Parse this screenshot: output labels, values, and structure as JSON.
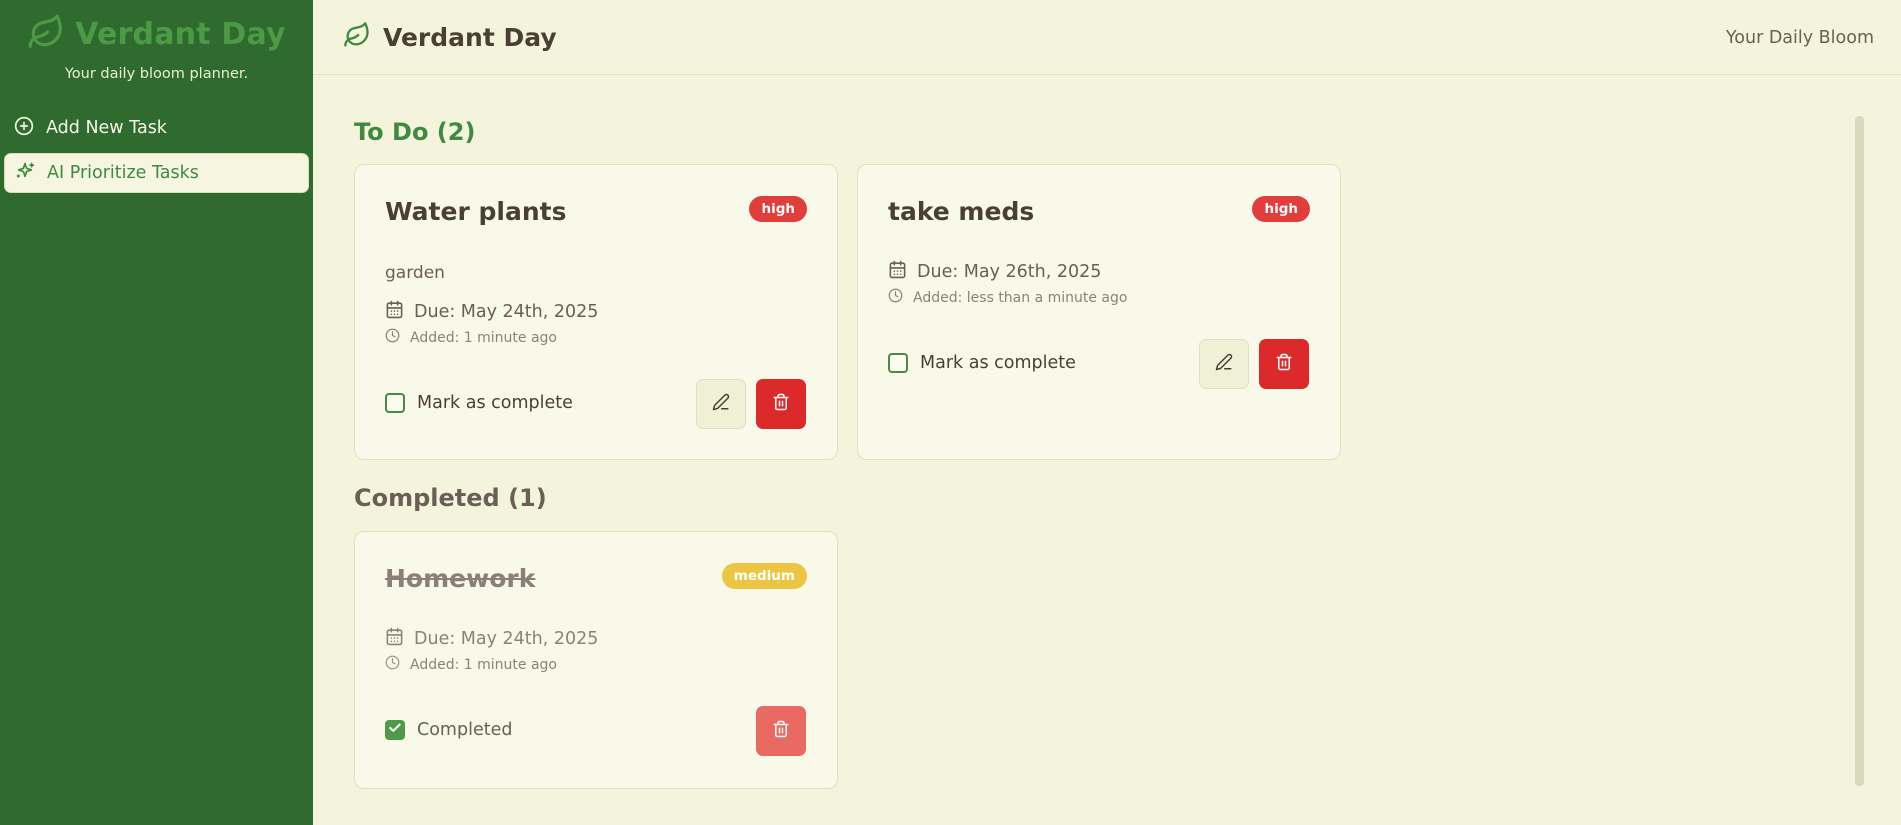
{
  "app": {
    "name": "Verdant Day",
    "tagline": "Your daily bloom planner.",
    "header_right": "Your Daily Bloom"
  },
  "sidebar": {
    "items": [
      {
        "label": "Add New Task",
        "icon": "plus-circle-icon"
      },
      {
        "label": "AI Prioritize Tasks",
        "icon": "sparkles-icon",
        "active": true
      }
    ]
  },
  "sections": {
    "todo_title": "To Do (2)",
    "completed_title": "Completed (1)"
  },
  "tasks": {
    "todo": [
      {
        "title": "Water plants",
        "priority": "high",
        "description": "garden",
        "due": "Due: May 24th, 2025",
        "added": "Added: 1 minute ago",
        "checkbox_label": "Mark as complete",
        "checked": false
      },
      {
        "title": "take meds",
        "priority": "high",
        "due": "Due: May 26th, 2025",
        "added": "Added: less than a minute ago",
        "checkbox_label": "Mark as complete",
        "checked": false
      }
    ],
    "completed": [
      {
        "title": "Homework",
        "priority": "medium",
        "due": "Due: May 24th, 2025",
        "added": "Added: 1 minute ago",
        "checkbox_label": "Completed",
        "checked": true
      }
    ]
  },
  "colors": {
    "sidebar_bg": "#2f6b2f",
    "page_bg": "#f4f4dc",
    "accent_green": "#3f8a3f",
    "priority_high": "#e23d3d",
    "priority_medium": "#ecc542",
    "delete_red": "#dc2a2a"
  }
}
